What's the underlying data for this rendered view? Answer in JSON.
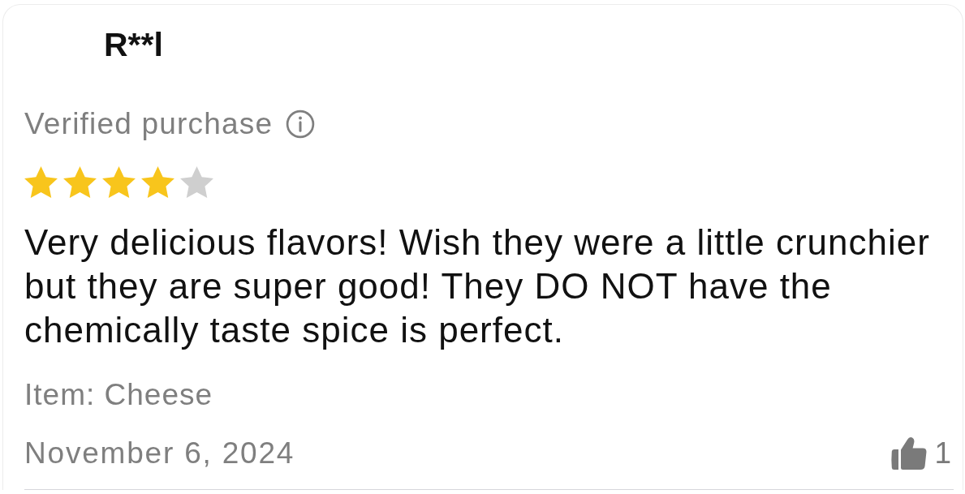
{
  "review": {
    "reviewer": "R**l",
    "verified_label": "Verified purchase",
    "stars": 4,
    "text": "Very delicious flavors! Wish they were a little crunchier but they are super good! They DO NOT have the chemically taste spice is perfect.",
    "item": "Item: Cheese",
    "date": "November 6, 2024",
    "helpful_count": "1"
  }
}
